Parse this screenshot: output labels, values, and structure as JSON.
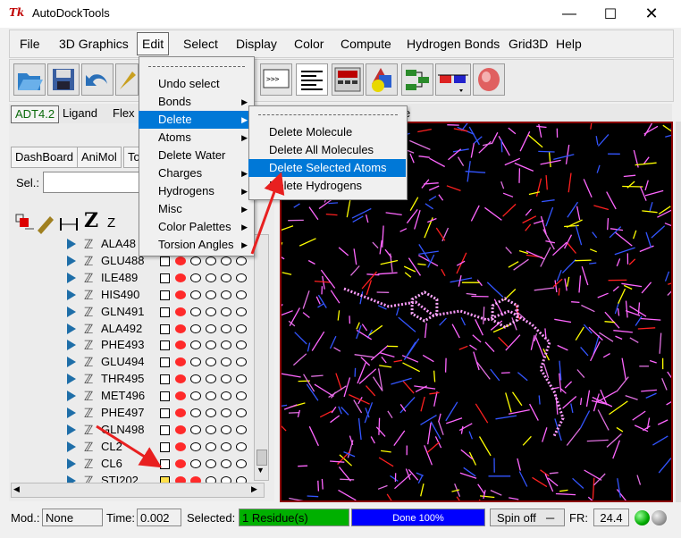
{
  "window": {
    "title": "AutoDockTools",
    "icon_text": "Tk"
  },
  "menubar": [
    "File",
    "3D Graphics",
    "Edit",
    "Select",
    "Display",
    "Color",
    "Compute",
    "Hydrogen Bonds",
    "Grid3D",
    "Help"
  ],
  "toptabs": [
    "ADT4.2",
    "Ligand",
    "Flex",
    "e"
  ],
  "left_tabs": [
    "DashBoard",
    "AniMol",
    "To"
  ],
  "sel_label": "Sel.:",
  "sel_value": "",
  "dash_header_z": "Z",
  "residues": [
    {
      "name": "ALA48",
      "checked": false,
      "red_dots": 1
    },
    {
      "name": "GLU488",
      "checked": false,
      "red_dots": 1
    },
    {
      "name": "ILE489",
      "checked": false,
      "red_dots": 1
    },
    {
      "name": "HIS490",
      "checked": false,
      "red_dots": 1
    },
    {
      "name": "GLN491",
      "checked": false,
      "red_dots": 1
    },
    {
      "name": "ALA492",
      "checked": false,
      "red_dots": 1
    },
    {
      "name": "PHE493",
      "checked": false,
      "red_dots": 1
    },
    {
      "name": "GLU494",
      "checked": false,
      "red_dots": 1
    },
    {
      "name": "THR495",
      "checked": false,
      "red_dots": 1
    },
    {
      "name": "MET496",
      "checked": false,
      "red_dots": 1
    },
    {
      "name": "PHE497",
      "checked": false,
      "red_dots": 1
    },
    {
      "name": "GLN498",
      "checked": false,
      "red_dots": 1
    },
    {
      "name": "CL2",
      "checked": false,
      "red_dots": 1
    },
    {
      "name": "CL6",
      "checked": false,
      "red_dots": 1
    },
    {
      "name": "STI202",
      "checked": true,
      "red_dots": 2
    }
  ],
  "edit_menu": [
    "Undo select",
    "Bonds",
    "Delete",
    "Atoms",
    "Delete Water",
    "Charges",
    "Hydrogens",
    "Misc",
    "Color Palettes",
    "Torsion Angles"
  ],
  "delete_menu": [
    "Delete Molecule",
    "Delete All Molecules",
    "Delete Selected Atoms",
    "Delete Hydrogens"
  ],
  "status": {
    "mod_label": "Mod.:",
    "mod_value": "None",
    "time_label": "Time:",
    "time_value": "0.002",
    "selected_label": "Selected:",
    "selected_value": "1 Residue(s)",
    "progress_text": "Done 100%",
    "spin": "Spin off",
    "fr_label": "FR:",
    "fr_value": "24.4"
  },
  "colors": {
    "selection": "#0078d7",
    "selected_field": "#00b000",
    "progress": "#0000ff",
    "viewer_border": "#8b0000",
    "arrow": "#e82020"
  }
}
